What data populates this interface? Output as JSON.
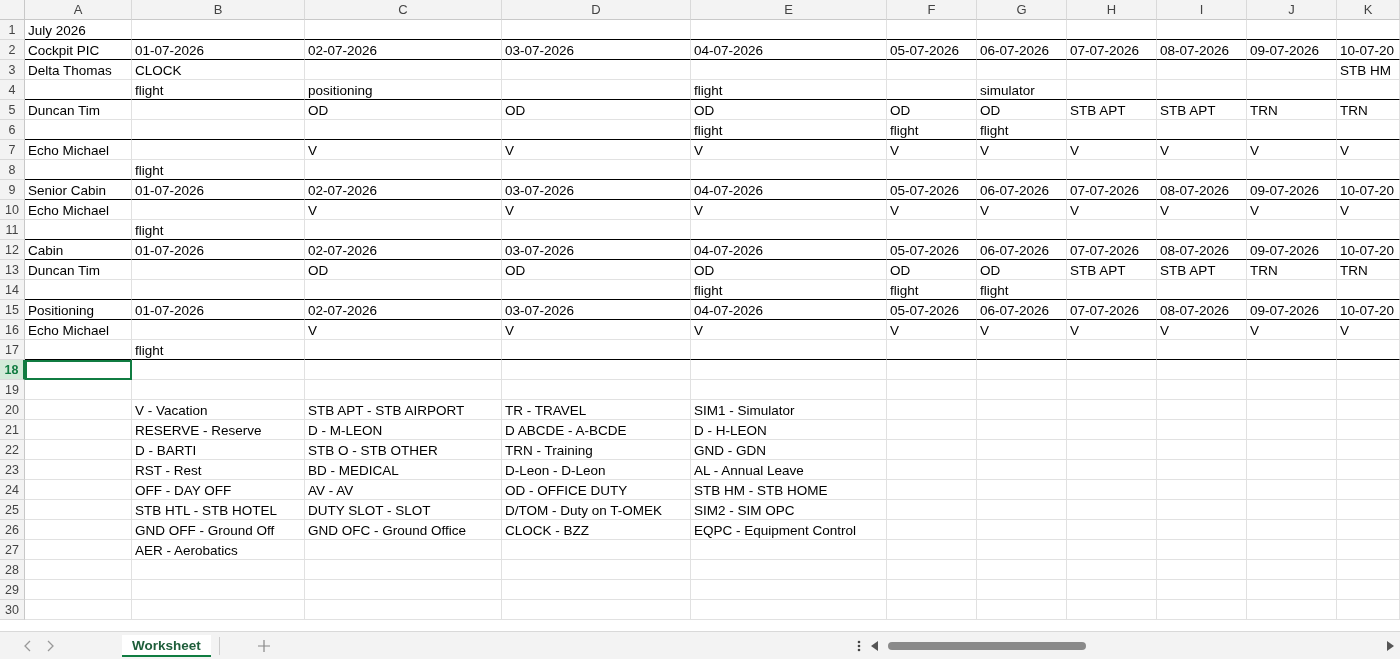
{
  "columns": [
    "A",
    "B",
    "C",
    "D",
    "E",
    "F",
    "G",
    "H",
    "I",
    "J",
    "K"
  ],
  "rows": [
    {
      "number": "1",
      "selected": false,
      "border_below": true,
      "cells": {
        "A": "July 2026"
      }
    },
    {
      "number": "2",
      "selected": false,
      "border_below": true,
      "cells": {
        "A": "Cockpit PIC",
        "B": "01-07-2026",
        "C": "02-07-2026",
        "D": "03-07-2026",
        "E": "04-07-2026",
        "F": "05-07-2026",
        "G": "06-07-2026",
        "H": "07-07-2026",
        "I": "08-07-2026",
        "J": "09-07-2026",
        "K": "10-07-20"
      }
    },
    {
      "number": "3",
      "selected": false,
      "border_below": false,
      "cells": {
        "A": "Delta Thomas",
        "B": "CLOCK",
        "K": "STB HM"
      }
    },
    {
      "number": "4",
      "selected": false,
      "border_below": true,
      "cells": {
        "B": "flight",
        "C": "positioning",
        "E": "flight",
        "G": "simulator"
      }
    },
    {
      "number": "5",
      "selected": false,
      "border_below": false,
      "cells": {
        "A": "Duncan Tim",
        "C": "OD",
        "D": "OD",
        "E": "OD",
        "F": "OD",
        "G": "OD",
        "H": "STB APT",
        "I": "STB APT",
        "J": "TRN",
        "K": "TRN"
      }
    },
    {
      "number": "6",
      "selected": false,
      "border_below": true,
      "cells": {
        "E": "flight",
        "F": "flight",
        "G": "flight"
      }
    },
    {
      "number": "7",
      "selected": false,
      "border_below": false,
      "cells": {
        "A": "Echo Michael",
        "C": "V",
        "D": "V",
        "E": "V",
        "F": "V",
        "G": "V",
        "H": "V",
        "I": "V",
        "J": "V",
        "K": "V"
      }
    },
    {
      "number": "8",
      "selected": false,
      "border_below": true,
      "cells": {
        "B": "flight"
      }
    },
    {
      "number": "9",
      "selected": false,
      "border_below": true,
      "cells": {
        "A": "Senior Cabin",
        "B": "01-07-2026",
        "C": "02-07-2026",
        "D": "03-07-2026",
        "E": "04-07-2026",
        "F": "05-07-2026",
        "G": "06-07-2026",
        "H": "07-07-2026",
        "I": "08-07-2026",
        "J": "09-07-2026",
        "K": "10-07-20"
      }
    },
    {
      "number": "10",
      "selected": false,
      "border_below": false,
      "cells": {
        "A": "Echo Michael",
        "C": "V",
        "D": "V",
        "E": "V",
        "F": "V",
        "G": "V",
        "H": "V",
        "I": "V",
        "J": "V",
        "K": "V"
      }
    },
    {
      "number": "11",
      "selected": false,
      "border_below": true,
      "cells": {
        "B": "flight"
      }
    },
    {
      "number": "12",
      "selected": false,
      "border_below": true,
      "cells": {
        "A": "Cabin",
        "B": "01-07-2026",
        "C": "02-07-2026",
        "D": "03-07-2026",
        "E": "04-07-2026",
        "F": "05-07-2026",
        "G": "06-07-2026",
        "H": "07-07-2026",
        "I": "08-07-2026",
        "J": "09-07-2026",
        "K": "10-07-20"
      }
    },
    {
      "number": "13",
      "selected": false,
      "border_below": false,
      "cells": {
        "A": "Duncan Tim",
        "C": "OD",
        "D": "OD",
        "E": "OD",
        "F": "OD",
        "G": "OD",
        "H": "STB APT",
        "I": "STB APT",
        "J": "TRN",
        "K": "TRN"
      }
    },
    {
      "number": "14",
      "selected": false,
      "border_below": true,
      "cells": {
        "E": "flight",
        "F": "flight",
        "G": "flight"
      }
    },
    {
      "number": "15",
      "selected": false,
      "border_below": true,
      "cells": {
        "A": "Positioning",
        "B": "01-07-2026",
        "C": "02-07-2026",
        "D": "03-07-2026",
        "E": "04-07-2026",
        "F": "05-07-2026",
        "G": "06-07-2026",
        "H": "07-07-2026",
        "I": "08-07-2026",
        "J": "09-07-2026",
        "K": "10-07-20"
      }
    },
    {
      "number": "16",
      "selected": false,
      "border_below": false,
      "cells": {
        "A": "Echo Michael",
        "C": "V",
        "D": "V",
        "E": "V",
        "F": "V",
        "G": "V",
        "H": "V",
        "I": "V",
        "J": "V",
        "K": "V"
      }
    },
    {
      "number": "17",
      "selected": false,
      "border_below": true,
      "cells": {
        "B": "flight"
      }
    },
    {
      "number": "18",
      "selected": true,
      "border_below": false,
      "cells": {}
    },
    {
      "number": "19",
      "selected": false,
      "border_below": false,
      "cells": {}
    },
    {
      "number": "20",
      "selected": false,
      "border_below": false,
      "cells": {
        "B": "V - Vacation",
        "C": "STB APT - STB AIRPORT",
        "D": "TR - TRAVEL",
        "E": "SIM1 - Simulator"
      }
    },
    {
      "number": "21",
      "selected": false,
      "border_below": false,
      "cells": {
        "B": "RESERVE - Reserve",
        "C": "D - M-LEON",
        "D": "D ABCDE - A-BCDE",
        "E": "D - H-LEON"
      }
    },
    {
      "number": "22",
      "selected": false,
      "border_below": false,
      "cells": {
        "B": "D - BARTI",
        "C": "STB O - STB OTHER",
        "D": "TRN - Training",
        "E": "GND - GDN"
      }
    },
    {
      "number": "23",
      "selected": false,
      "border_below": false,
      "cells": {
        "B": "RST - Rest",
        "C": "BD - MEDICAL",
        "D": "D-Leon - D-Leon",
        "E": "AL - Annual Leave"
      }
    },
    {
      "number": "24",
      "selected": false,
      "border_below": false,
      "cells": {
        "B": "OFF - DAY OFF",
        "C": "AV - AV",
        "D": "OD - OFFICE DUTY",
        "E": "STB HM - STB HOME"
      }
    },
    {
      "number": "25",
      "selected": false,
      "border_below": false,
      "cells": {
        "B": "STB HTL - STB HOTEL",
        "C": "DUTY SLOT - SLOT",
        "D": "D/TOM - Duty on T-OMEK",
        "E": "SIM2 - SIM OPC"
      }
    },
    {
      "number": "26",
      "selected": false,
      "border_below": false,
      "cells": {
        "B": "GND OFF - Ground Off",
        "C": "GND OFC - Ground Office",
        "D": "CLOCK - BZZ",
        "E": "EQPC - Equipment Control"
      }
    },
    {
      "number": "27",
      "selected": false,
      "border_below": false,
      "cells": {
        "B": "AER - Aerobatics"
      }
    },
    {
      "number": "28",
      "selected": false,
      "border_below": false,
      "cells": {}
    },
    {
      "number": "29",
      "selected": false,
      "border_below": false,
      "cells": {}
    },
    {
      "number": "30",
      "selected": false,
      "border_below": false,
      "cells": {}
    }
  ],
  "sheet_tabs": [
    {
      "label": "Worksheet",
      "selected": true
    }
  ]
}
